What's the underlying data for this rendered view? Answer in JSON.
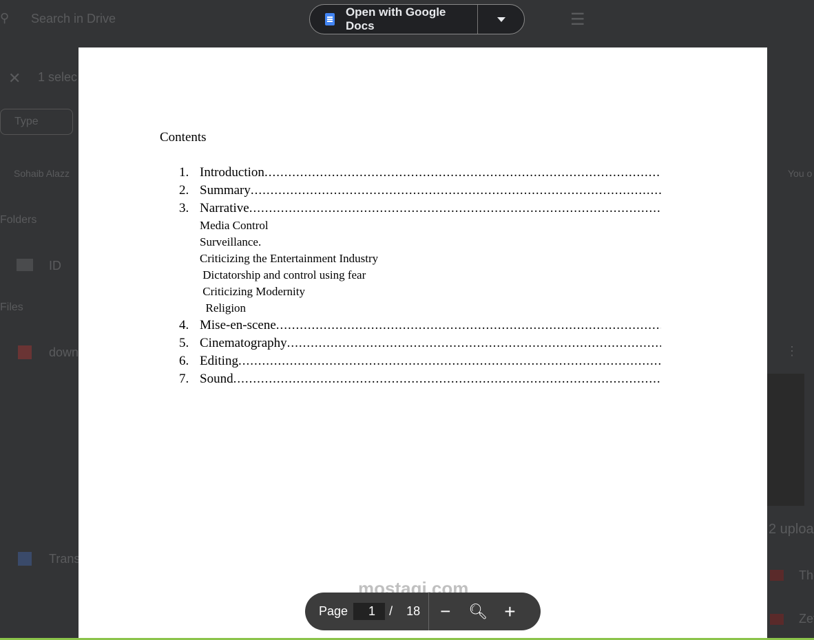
{
  "background": {
    "search_placeholder": "Search in Drive",
    "selection": "1 selec",
    "type_filter": "Type",
    "owner": "Sohaib Alazz",
    "folders_heading": "Folders",
    "folder": "ID",
    "files_heading": "Files",
    "file1": "down",
    "file2": "Trans",
    "right_owner": "You o",
    "uploads": "2 uploa",
    "upload1": "The",
    "upload2": "Zet"
  },
  "toolbar": {
    "open_with": "Open with Google Docs"
  },
  "document": {
    "title": "Contents",
    "items": [
      {
        "n": "1.",
        "t": "Introduction"
      },
      {
        "n": "2.",
        "t": "Summary"
      },
      {
        "n": "3.",
        "t": "Narrative"
      }
    ],
    "subitems": [
      "Media Control",
      "Surveillance.",
      "Criticizing the Entertainment Industry",
      " Dictatorship and control using fear",
      " Criticizing Modernity",
      "  Religion"
    ],
    "items2": [
      {
        "n": "4.",
        "t": "Mise-en-scene"
      },
      {
        "n": "5.",
        "t": "Cinematography"
      },
      {
        "n": "6.",
        "t": "Editing"
      },
      {
        "n": "7.",
        "t": "Sound"
      }
    ]
  },
  "pager": {
    "label": "Page",
    "current": "1",
    "sep": "/",
    "total": "18"
  },
  "watermark": "mostaqi.com"
}
